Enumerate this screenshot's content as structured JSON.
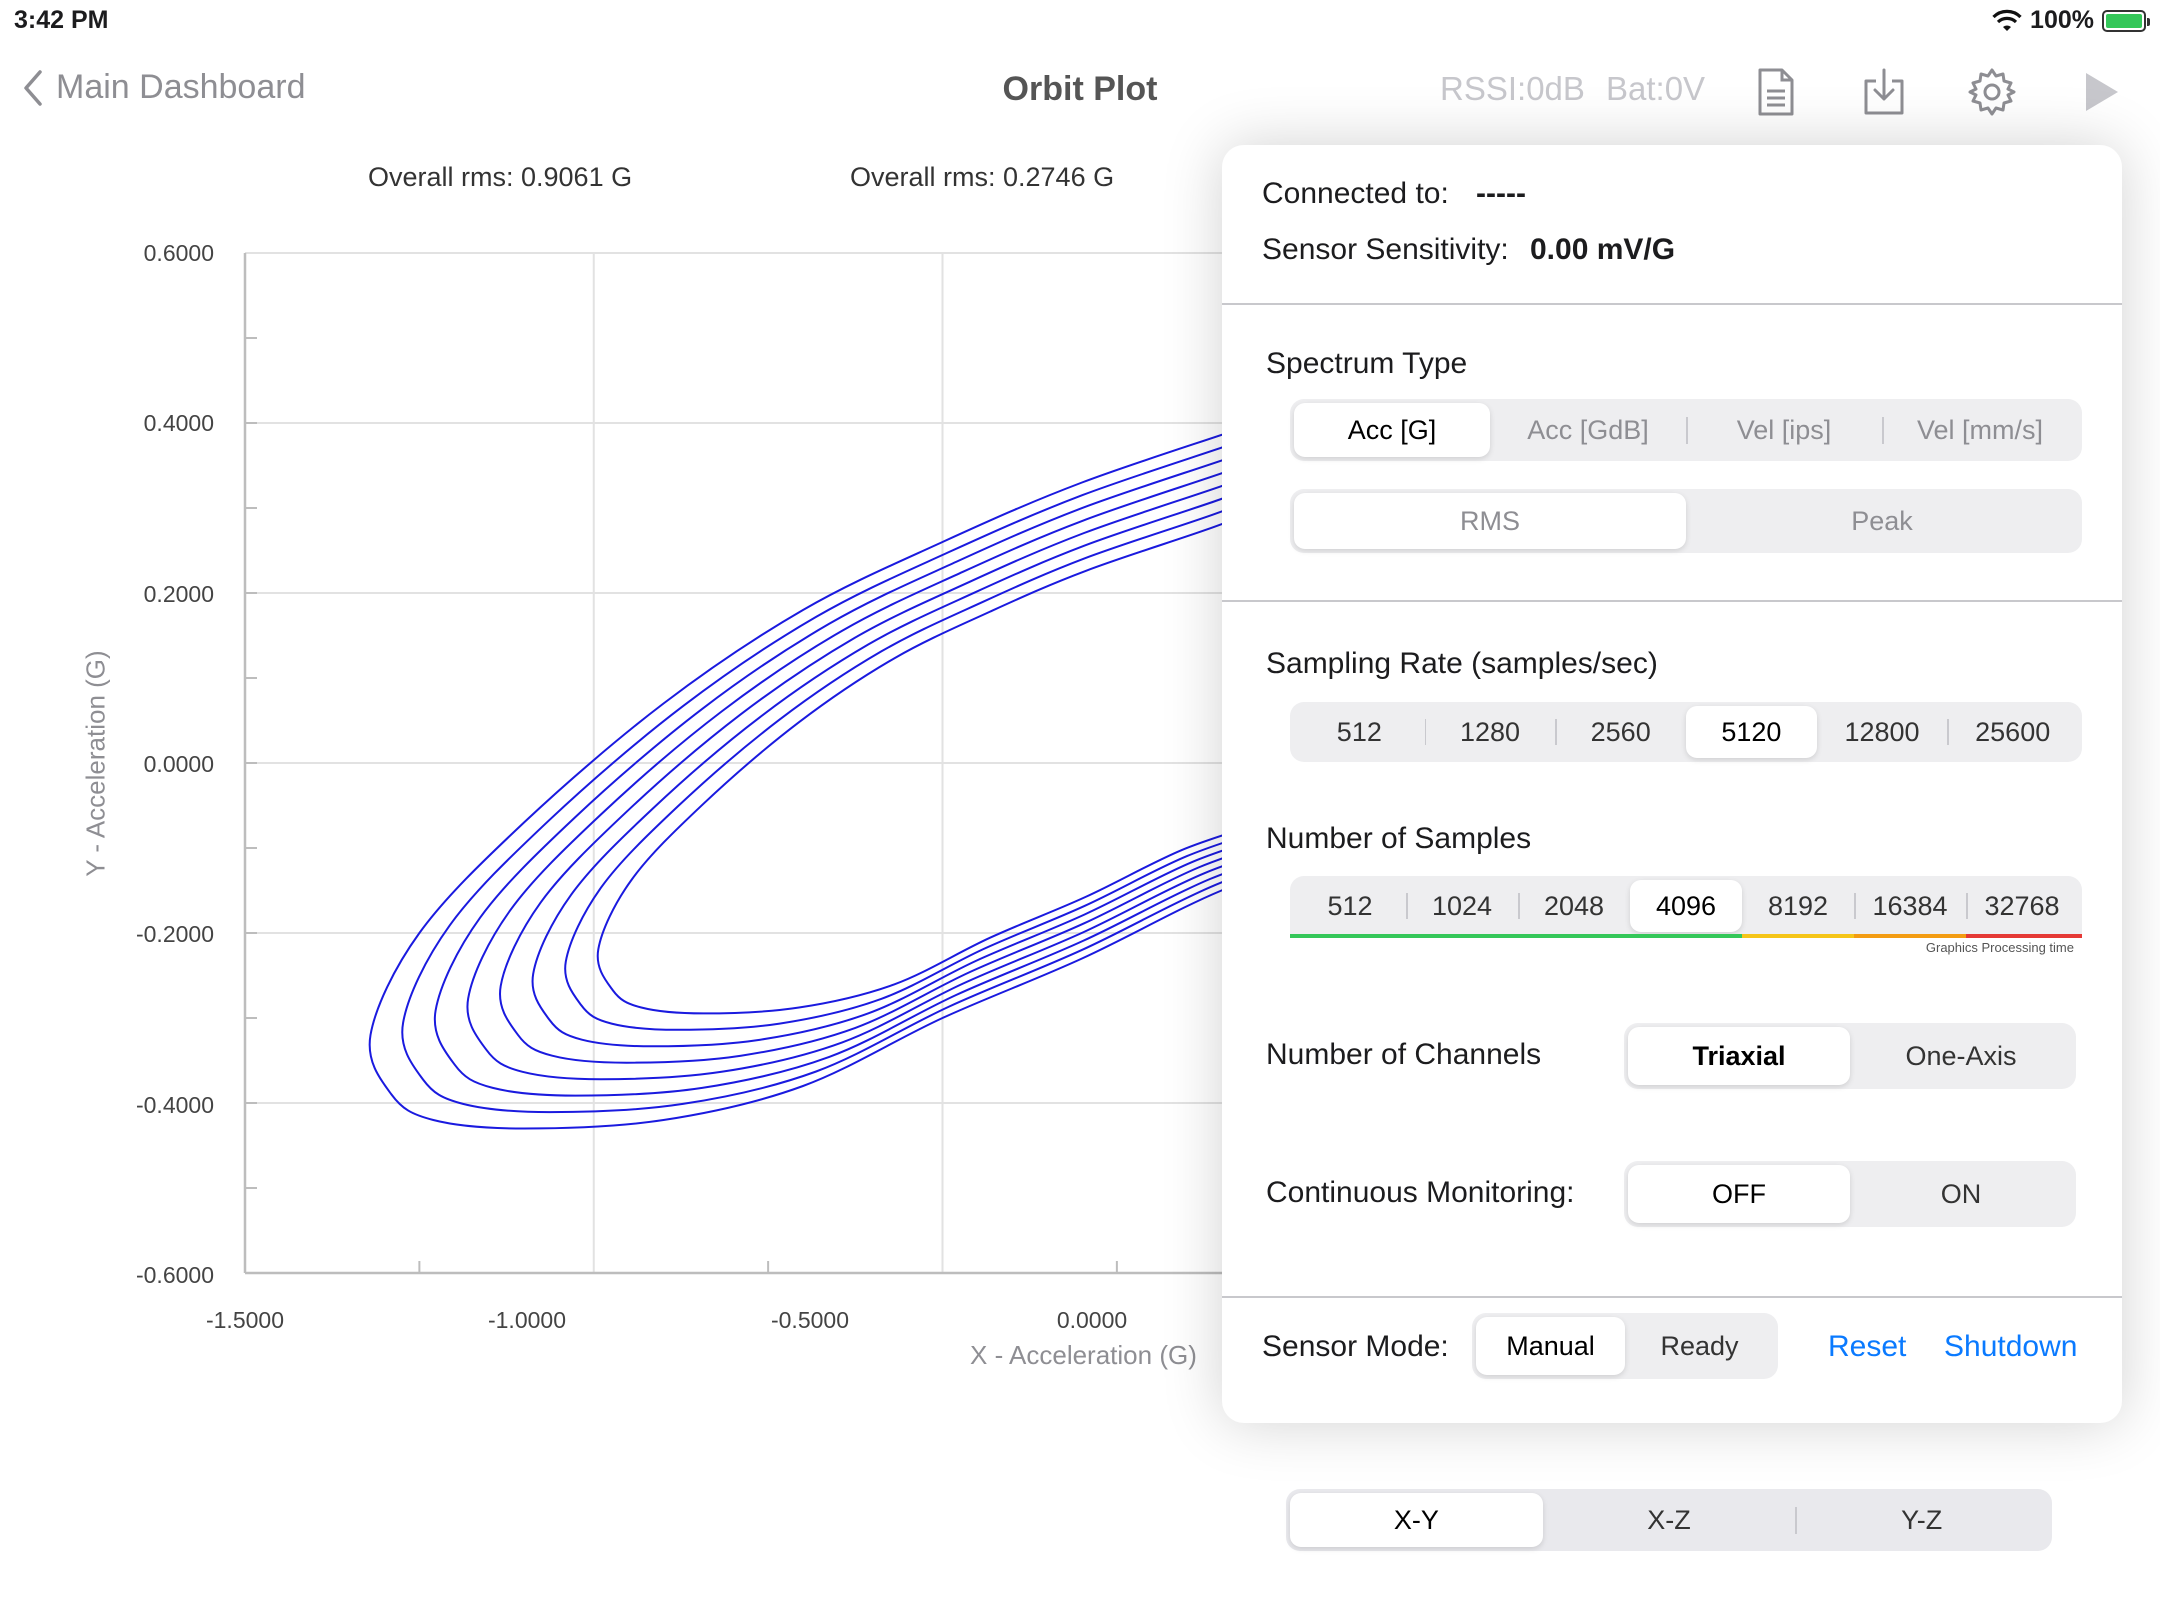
{
  "status_bar": {
    "time": "3:42 PM",
    "battery_text": "100%",
    "battery_level": 1.0
  },
  "nav": {
    "back_label": "Main Dashboard",
    "title": "Orbit Plot",
    "rssi": "RSSI:0dB",
    "bat": "Bat:0V",
    "icons": [
      "chevron-left-icon",
      "document-icon",
      "download-icon",
      "gear-icon",
      "play-icon"
    ]
  },
  "chart_header": {
    "rms_left": "Overall rms: 0.9061 G",
    "rms_right": "Overall rms: 0.2746 G"
  },
  "chart_data": {
    "type": "line",
    "xlabel": "X - Acceleration (G)",
    "ylabel": "Y - Acceleration (G)",
    "x_ticks": [
      "-1.5000",
      "-1.0000",
      "-0.5000",
      "0.0000"
    ],
    "y_ticks": [
      "0.6000",
      "0.4000",
      "0.2000",
      "0.0000",
      "-0.2000",
      "-0.4000",
      "-0.6000"
    ],
    "xlim": [
      -1.5,
      0.0
    ],
    "ylim": [
      -0.6,
      0.6
    ],
    "grid": true,
    "series_color": "#1a1adf",
    "orbit_loops": 8,
    "upper_branch": [
      [
        -1.32,
        -0.32
      ],
      [
        -1.25,
        -0.2
      ],
      [
        -1.1,
        -0.07
      ],
      [
        -0.9,
        0.07
      ],
      [
        -0.7,
        0.18
      ],
      [
        -0.5,
        0.26
      ],
      [
        -0.3,
        0.33
      ],
      [
        -0.05,
        0.4
      ],
      [
        0.08,
        0.44
      ]
    ],
    "lower_branch": [
      [
        -1.32,
        -0.32
      ],
      [
        -1.29,
        -0.39
      ],
      [
        -1.23,
        -0.42
      ],
      [
        -1.1,
        -0.43
      ],
      [
        -0.9,
        -0.42
      ],
      [
        -0.7,
        -0.38
      ],
      [
        -0.5,
        -0.3
      ],
      [
        -0.3,
        -0.23
      ],
      [
        -0.1,
        -0.15
      ],
      [
        0.08,
        -0.1
      ]
    ]
  },
  "popover": {
    "connected_label": "Connected to:",
    "connected_value": "-----",
    "sensitivity_label": "Sensor Sensitivity:",
    "sensitivity_value": "0.00 mV/G",
    "spectrum_title": "Spectrum Type",
    "spectrum_options": [
      "Acc [G]",
      "Acc [GdB]",
      "Vel [ips]",
      "Vel [mm/s]"
    ],
    "spectrum_selected": 0,
    "measure_options": [
      "RMS",
      "Peak"
    ],
    "measure_selected": 0,
    "sampling_title": "Sampling Rate (samples/sec)",
    "sampling_options": [
      "512",
      "1280",
      "2560",
      "5120",
      "12800",
      "25600"
    ],
    "sampling_selected": 3,
    "samples_title": "Number of Samples",
    "samples_options": [
      "512",
      "1024",
      "2048",
      "4096",
      "8192",
      "16384",
      "32768"
    ],
    "samples_selected": 3,
    "graphics_note": "Graphics Processing time",
    "indicator_colors": [
      "#34c759",
      "#f5c518",
      "#f39c12",
      "#e53935"
    ],
    "channels_title": "Number of Channels",
    "channels_options": [
      "Triaxial",
      "One-Axis"
    ],
    "channels_selected": 0,
    "monitoring_title": "Continuous Monitoring:",
    "monitoring_options": [
      "OFF",
      "ON"
    ],
    "monitoring_selected": 0,
    "mode_title": "Sensor Mode:",
    "mode_options": [
      "Manual",
      "Ready"
    ],
    "mode_selected": 0,
    "reset_label": "Reset",
    "shutdown_label": "Shutdown",
    "accent": "#0a7aff"
  },
  "plane_selector": {
    "options": [
      "X-Y",
      "X-Z",
      "Y-Z"
    ],
    "selected": 0
  }
}
